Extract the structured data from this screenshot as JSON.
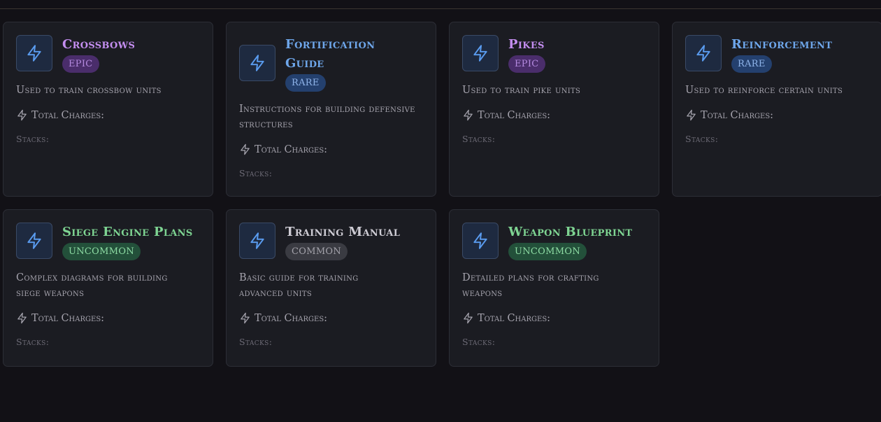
{
  "colors": {
    "epic": "#c48ef0",
    "rare": "#6ea6ea",
    "uncommon": "#7ed492",
    "common": "#cdcbd3",
    "icon_accent": "#5a9cf0"
  },
  "items": [
    {
      "title": "Crossbows",
      "rarity": "Epic",
      "description": "Used to train crossbow units",
      "charges_label": "Total Charges:",
      "stacks_label": "Stacks:",
      "icon": "lightning-icon"
    },
    {
      "title": "Fortification Guide",
      "rarity": "Rare",
      "description": "Instructions for building defensive structures",
      "charges_label": "Total Charges:",
      "stacks_label": "Stacks:",
      "icon": "lightning-icon"
    },
    {
      "title": "Pikes",
      "rarity": "Epic",
      "description": "Used to train pike units",
      "charges_label": "Total Charges:",
      "stacks_label": "Stacks:",
      "icon": "lightning-icon"
    },
    {
      "title": "Reinforcement",
      "rarity": "Rare",
      "description": "Used to reinforce certain units",
      "charges_label": "Total Charges:",
      "stacks_label": "Stacks:",
      "icon": "lightning-icon"
    },
    {
      "title": "Siege Engine Plans",
      "rarity": "Uncommon",
      "description": "Complex diagrams for building siege weapons",
      "charges_label": "Total Charges:",
      "stacks_label": "Stacks:",
      "icon": "lightning-icon"
    },
    {
      "title": "Training Manual",
      "rarity": "Common",
      "description": "Basic guide for training advanced units",
      "charges_label": "Total Charges:",
      "stacks_label": "Stacks:",
      "icon": "lightning-icon"
    },
    {
      "title": "Weapon Blueprint",
      "rarity": "Uncommon",
      "description": "Detailed plans for crafting weapons",
      "charges_label": "Total Charges:",
      "stacks_label": "Stacks:",
      "icon": "lightning-icon"
    }
  ]
}
